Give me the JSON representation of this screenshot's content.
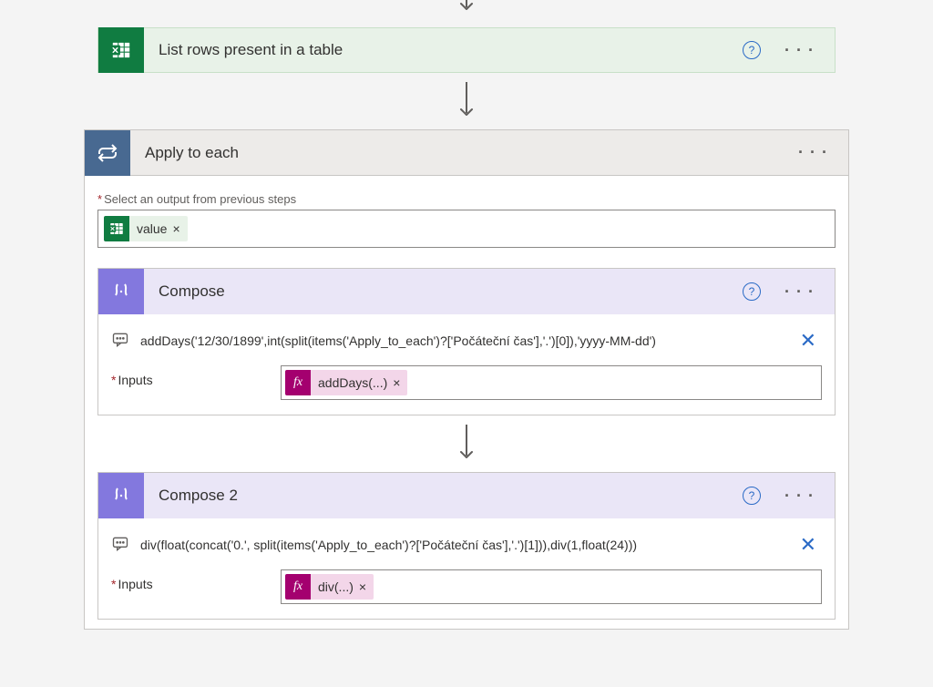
{
  "excelAction": {
    "title": "List rows present in a table"
  },
  "applyToEach": {
    "title": "Apply to each",
    "selectLabel": "Select an output from previous steps",
    "tokenLabel": "value"
  },
  "compose1": {
    "title": "Compose",
    "expression": "addDays('12/30/1899',int(split(items('Apply_to_each')?['Počáteční čas'],'.')[0]),'yyyy-MM-dd')",
    "inputsLabel": "Inputs",
    "fxTokenLabel": "addDays(...)"
  },
  "compose2": {
    "title": "Compose 2",
    "expression": "div(float(concat('0.', split(items('Apply_to_each')?['Počáteční čas'],'.')[1])),div(1,float(24)))",
    "inputsLabel": "Inputs",
    "fxTokenLabel": "div(...)"
  },
  "fxSymbol": "fx",
  "removeSymbol": "×",
  "closeSymbol": "✕",
  "helpSymbol": "?",
  "ellipsisSymbol": "· · ·"
}
